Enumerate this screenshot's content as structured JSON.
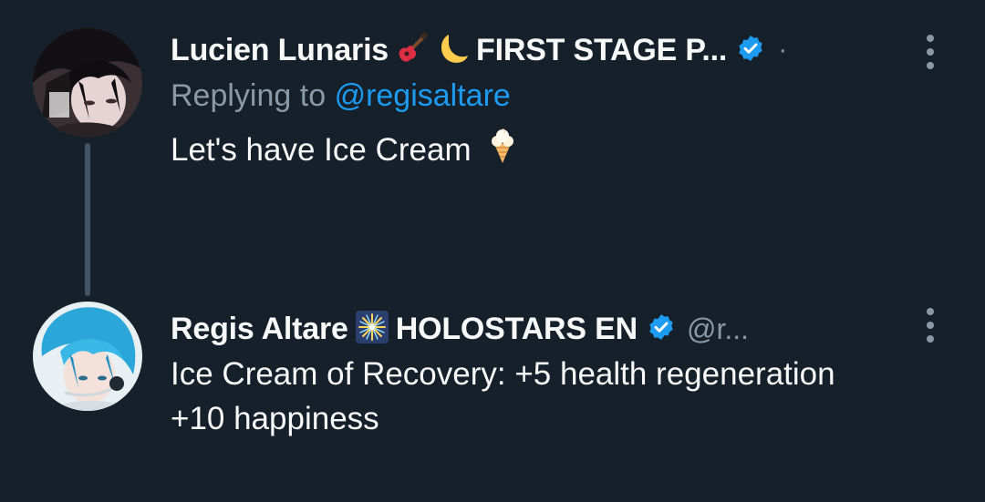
{
  "colors": {
    "background": "#15202b",
    "primary_text": "#f7f9f9",
    "secondary_text": "#8b98a5",
    "accent": "#1d9bf0",
    "thread_line": "#425364"
  },
  "tweets": [
    {
      "display_name": "Lucien Lunaris",
      "emojis": [
        "guitar-icon",
        "crescent-moon-icon"
      ],
      "name_suffix": "FIRST STAGE P...",
      "verified": true,
      "separator": "·",
      "replying_prefix": "Replying to",
      "replying_handle": "@regisaltare",
      "text": "Let's have Ice Cream",
      "text_emoji": "ice-cream-icon"
    },
    {
      "display_name": "Regis Altare",
      "emojis": [
        "sparkler-icon"
      ],
      "name_suffix": "HOLOSTARS EN",
      "verified": true,
      "handle": "@r...",
      "text_line_1": "Ice Cream of Recovery: +5 health regeneration",
      "text_line_2": "+10 happiness"
    }
  ]
}
